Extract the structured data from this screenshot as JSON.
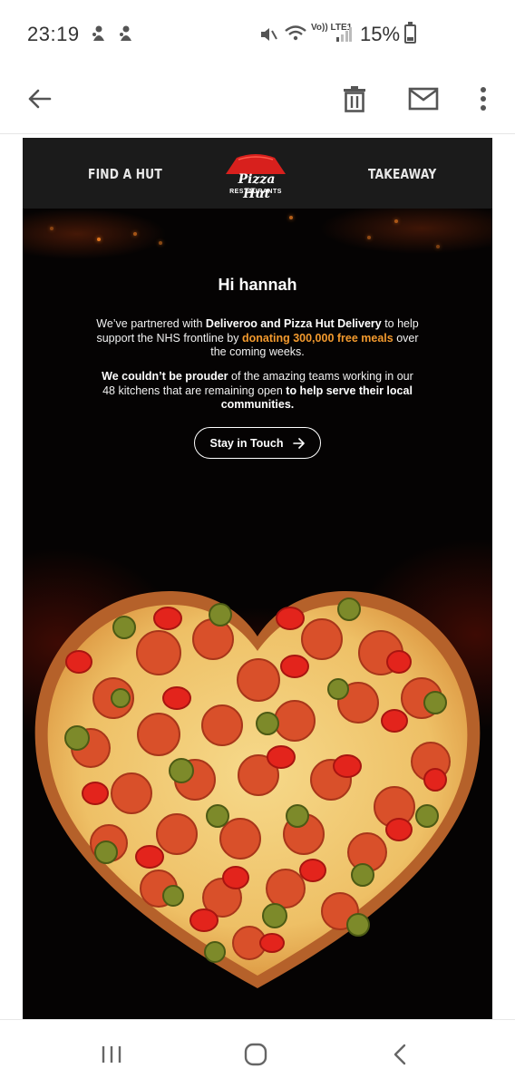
{
  "status_bar": {
    "time": "23:19",
    "network": "Vo)) LTE1",
    "battery": "15%"
  },
  "app_bar": {
    "icons": [
      "back-arrow-icon",
      "trash-icon",
      "mail-icon",
      "more-vert-icon"
    ]
  },
  "email": {
    "nav_left": "FIND A HUT",
    "nav_right": "TAKEAWAY",
    "logo_script": "Pizza Hut",
    "logo_sub": "RESTAURANTS",
    "greeting": "Hi hannah",
    "p1": {
      "t1": "We’ve partnered with ",
      "b1": "Deliveroo and Pizza Hut Delivery",
      "t2": " to help support the NHS frontline by ",
      "o1": "donating 300,000 free meals",
      "t3": " over the coming weeks."
    },
    "p2": {
      "b1": "We couldn’t be prouder",
      "t1": " of the amazing teams working in our 48 kitchens that are remaining open ",
      "b2": "to help serve their local communities."
    },
    "cta_label": "Stay in Touch",
    "accent_color": "#f39a2e"
  },
  "nav_bar": {
    "icons": [
      "recents-icon",
      "home-icon",
      "back-icon"
    ]
  }
}
